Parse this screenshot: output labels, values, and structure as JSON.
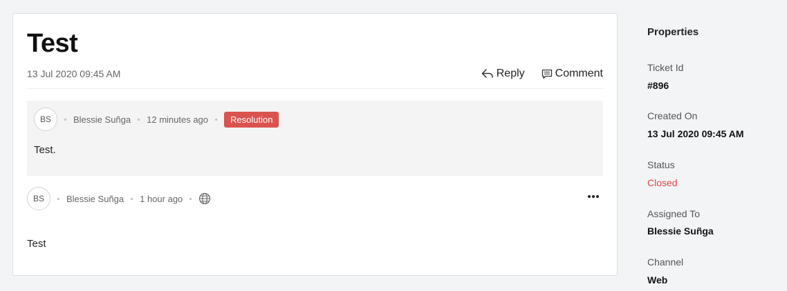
{
  "ticket": {
    "title": "Test",
    "date": "13 Jul 2020 09:45 AM",
    "actions": {
      "reply": "Reply",
      "comment": "Comment"
    }
  },
  "threads": [
    {
      "initials": "BS",
      "author": "Blessie Suñga",
      "time": "12 minutes ago",
      "badge": "Resolution",
      "body": "Test."
    },
    {
      "initials": "BS",
      "author": "Blessie Suñga",
      "time": "1 hour ago",
      "channel_icon": "globe-icon",
      "body": "Test"
    }
  ],
  "properties": {
    "heading": "Properties",
    "ticket_id": {
      "label": "Ticket Id",
      "value": "#896"
    },
    "created_on": {
      "label": "Created On",
      "value": "13 Jul 2020 09:45 AM"
    },
    "status": {
      "label": "Status",
      "value": "Closed"
    },
    "assigned_to": {
      "label": "Assigned To",
      "value": "Blessie Suñga"
    },
    "channel": {
      "label": "Channel",
      "value": "Web"
    }
  },
  "colors": {
    "badge": "#d9534f",
    "status_closed": "#e0474c",
    "background": "#f3f4f5"
  }
}
